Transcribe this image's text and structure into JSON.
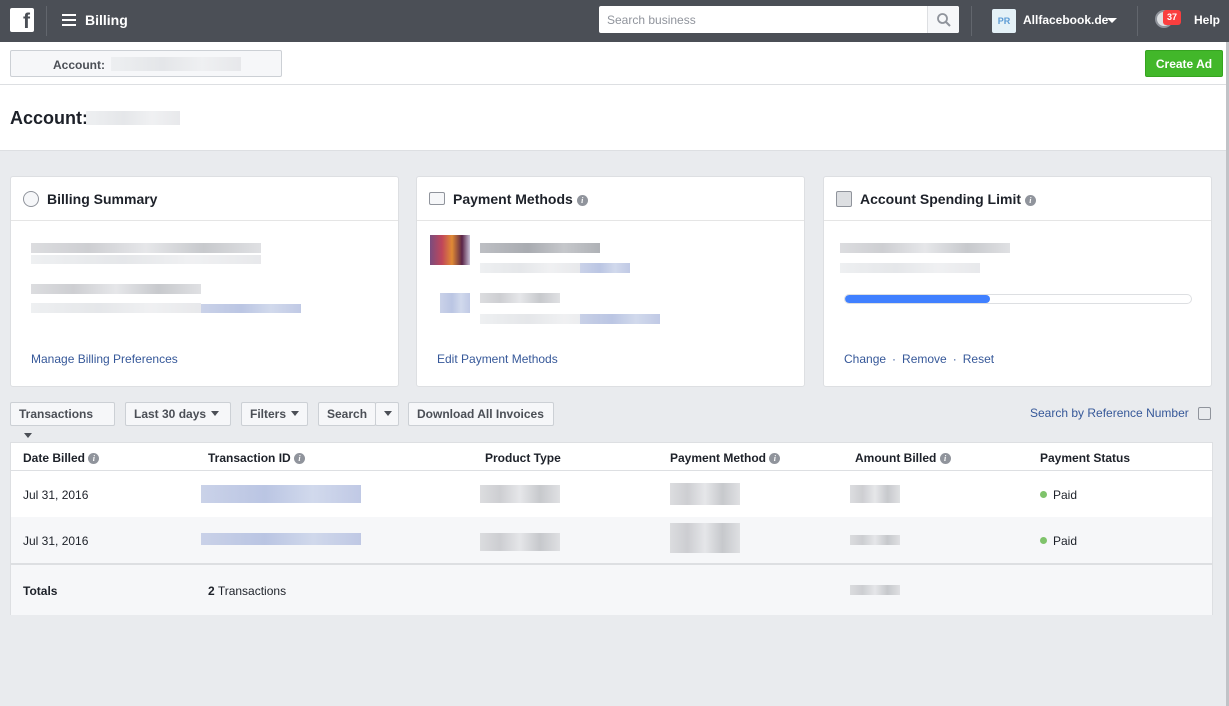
{
  "topbar": {
    "title": "Billing",
    "search_placeholder": "Search business",
    "business_initials": "PR",
    "business_name": "Allfacebook.de",
    "notification_count": "37",
    "help_label": "Help"
  },
  "account_bar": {
    "selector_label": "Account:",
    "create_ad_label": "Create Ad"
  },
  "header": {
    "title": "Account:"
  },
  "cards": {
    "billing_summary": {
      "title": "Billing Summary",
      "link": "Manage Billing Preferences"
    },
    "payment_methods": {
      "title": "Payment Methods",
      "link": "Edit Payment Methods"
    },
    "spending_limit": {
      "title": "Account Spending Limit",
      "progress_fraction": 0.42,
      "actions": [
        "Change",
        "Remove",
        "Reset"
      ]
    }
  },
  "toolbar": {
    "transactions_label": "Transactions",
    "date_range_label": "Last 30 days",
    "filters_label": "Filters",
    "search_label": "Search",
    "download_label": "Download All Invoices",
    "reference_link": "Search by Reference Number"
  },
  "table": {
    "columns": [
      "Date Billed",
      "Transaction ID",
      "Product Type",
      "Payment Method",
      "Amount Billed",
      "Payment Status"
    ],
    "rows": [
      {
        "date": "Jul 31, 2016",
        "status": "Paid"
      },
      {
        "date": "Jul 31, 2016",
        "status": "Paid"
      }
    ],
    "totals_label": "Totals",
    "totals_count": "2",
    "totals_suffix": "Transactions"
  },
  "colors": {
    "topbar": "#4b4f56",
    "link": "#365899",
    "create_ad": "#42b72a",
    "progress": "#4080ff",
    "paid_dot": "#7fc36b",
    "badge": "#fa3e3e"
  }
}
